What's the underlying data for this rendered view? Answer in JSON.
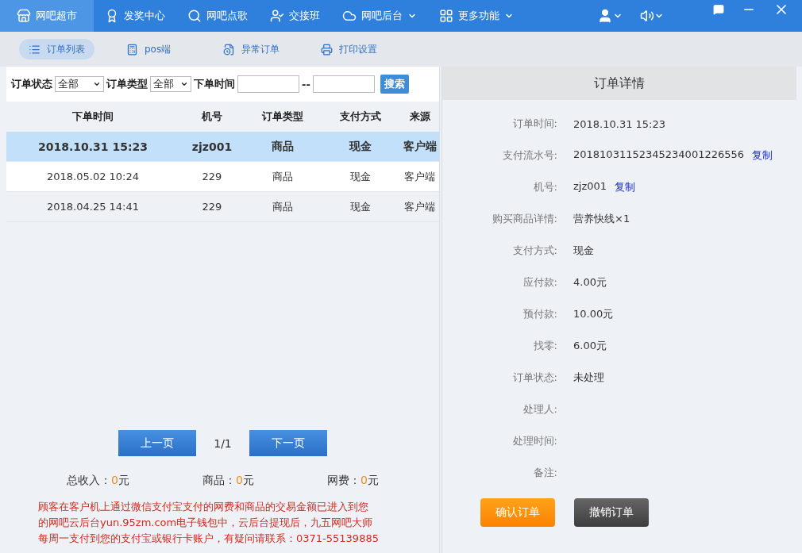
{
  "nav": {
    "items": [
      {
        "label": "网吧超市",
        "selected": true,
        "dropdown": false
      },
      {
        "label": "发奖中心",
        "selected": false,
        "dropdown": false
      },
      {
        "label": "网吧点歌",
        "selected": false,
        "dropdown": false
      },
      {
        "label": "交接班",
        "selected": false,
        "dropdown": false
      },
      {
        "label": "网吧后台",
        "selected": false,
        "dropdown": true
      },
      {
        "label": "更多功能",
        "selected": false,
        "dropdown": true
      }
    ]
  },
  "subtabs": [
    {
      "label": "订单列表",
      "selected": true
    },
    {
      "label": "pos端",
      "selected": false
    },
    {
      "label": "异常订单",
      "selected": false
    },
    {
      "label": "打印设置",
      "selected": false
    }
  ],
  "filter": {
    "status_label": "订单状态",
    "status_value": "全部",
    "type_label": "订单类型",
    "type_value": "全部",
    "time_label": "下单时间",
    "range_separator": "--",
    "search_button": "搜索"
  },
  "table": {
    "columns": [
      "下单时间",
      "机号",
      "订单类型",
      "支付方式",
      "来源"
    ],
    "rows": [
      {
        "selected": true,
        "cells": [
          "2018.10.31 15:23",
          "zjz001",
          "商品",
          "现金",
          "客户端"
        ]
      },
      {
        "selected": false,
        "cells": [
          "2018.05.02 10:24",
          "229",
          "商品",
          "现金",
          "客户端"
        ]
      },
      {
        "selected": false,
        "cells": [
          "2018.04.25 14:41",
          "229",
          "商品",
          "现金",
          "客户端"
        ]
      }
    ]
  },
  "pagination": {
    "prev": "上一页",
    "page": "1/1",
    "next": "下一页"
  },
  "totals": [
    {
      "label": "总收入：",
      "amount": "0",
      "unit": "元"
    },
    {
      "label": "商品：",
      "amount": "0",
      "unit": "元"
    },
    {
      "label": "网费：",
      "amount": "0",
      "unit": "元"
    }
  ],
  "notice": [
    "顾客在客户机上通过微信支付宝支付的网费和商品的交易金额已进入到您",
    "的网吧云后台yun.95zm.com电子钱包中，云后台提现后，九五网吧大师",
    "每周一支付到您的支付宝或银行卡账户，有疑问请联系：0371-55139885"
  ],
  "detail": {
    "title": "订单详情",
    "fields": [
      {
        "label": "订单时间:",
        "value": "2018.10.31 15:23"
      },
      {
        "label": "支付流水号:",
        "value": "20181031152345234001226556",
        "copy": "复制"
      },
      {
        "label": "机号:",
        "value": "zjz001",
        "copy": "复制"
      },
      {
        "label": "购买商品详情:",
        "value": "营养快线×1"
      },
      {
        "label": "支付方式:",
        "value": "现金"
      },
      {
        "label": "应付款:",
        "value": "4.00元"
      },
      {
        "label": "预付款:",
        "value": "10.00元"
      },
      {
        "label": "找零:",
        "value": "6.00元"
      },
      {
        "label": "订单状态:",
        "value": "未处理"
      },
      {
        "label": "处理人:"
      },
      {
        "label": "处理时间:"
      },
      {
        "label": "备注:"
      }
    ],
    "buttons": [
      {
        "label": "确认订单",
        "kind": "confirm"
      },
      {
        "label": "撤销订单",
        "kind": "cancel"
      }
    ]
  }
}
